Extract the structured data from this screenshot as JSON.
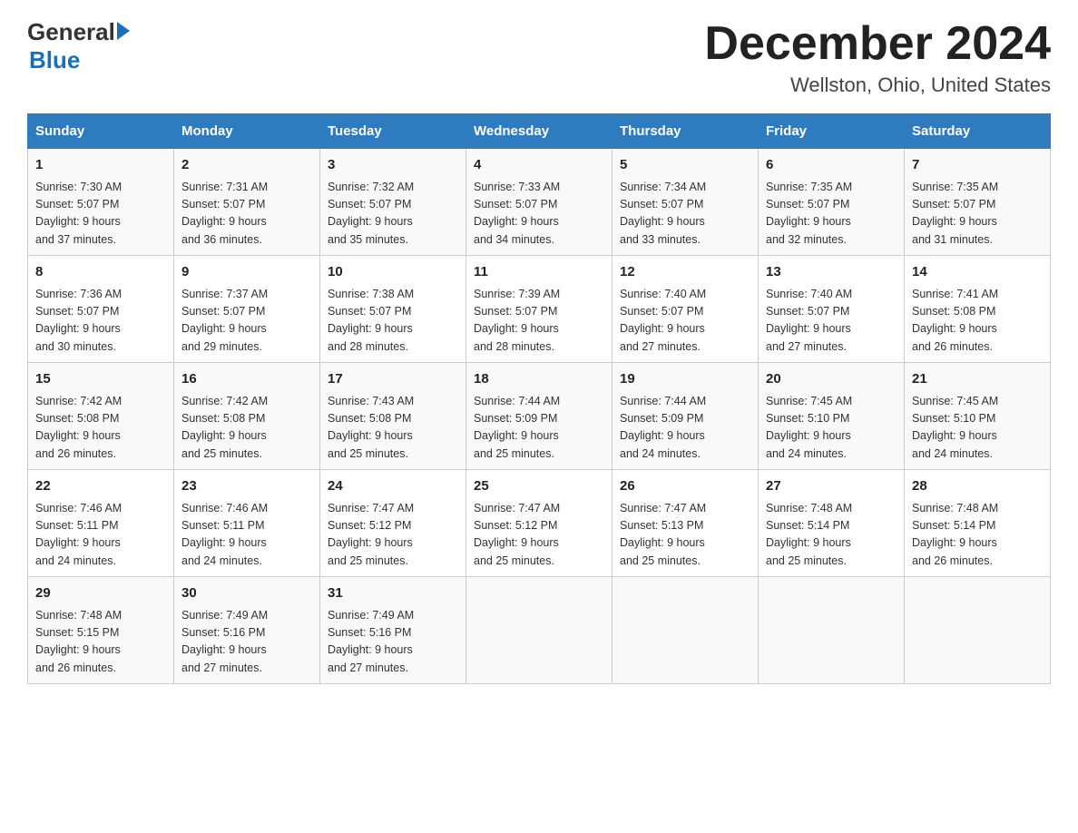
{
  "header": {
    "logo": {
      "general": "General",
      "arrow": "▶",
      "blue": "Blue"
    },
    "title": "December 2024",
    "location": "Wellston, Ohio, United States"
  },
  "days_of_week": [
    "Sunday",
    "Monday",
    "Tuesday",
    "Wednesday",
    "Thursday",
    "Friday",
    "Saturday"
  ],
  "weeks": [
    [
      {
        "day": "1",
        "sunrise": "7:30 AM",
        "sunset": "5:07 PM",
        "daylight": "9 hours and 37 minutes."
      },
      {
        "day": "2",
        "sunrise": "7:31 AM",
        "sunset": "5:07 PM",
        "daylight": "9 hours and 36 minutes."
      },
      {
        "day": "3",
        "sunrise": "7:32 AM",
        "sunset": "5:07 PM",
        "daylight": "9 hours and 35 minutes."
      },
      {
        "day": "4",
        "sunrise": "7:33 AM",
        "sunset": "5:07 PM",
        "daylight": "9 hours and 34 minutes."
      },
      {
        "day": "5",
        "sunrise": "7:34 AM",
        "sunset": "5:07 PM",
        "daylight": "9 hours and 33 minutes."
      },
      {
        "day": "6",
        "sunrise": "7:35 AM",
        "sunset": "5:07 PM",
        "daylight": "9 hours and 32 minutes."
      },
      {
        "day": "7",
        "sunrise": "7:35 AM",
        "sunset": "5:07 PM",
        "daylight": "9 hours and 31 minutes."
      }
    ],
    [
      {
        "day": "8",
        "sunrise": "7:36 AM",
        "sunset": "5:07 PM",
        "daylight": "9 hours and 30 minutes."
      },
      {
        "day": "9",
        "sunrise": "7:37 AM",
        "sunset": "5:07 PM",
        "daylight": "9 hours and 29 minutes."
      },
      {
        "day": "10",
        "sunrise": "7:38 AM",
        "sunset": "5:07 PM",
        "daylight": "9 hours and 28 minutes."
      },
      {
        "day": "11",
        "sunrise": "7:39 AM",
        "sunset": "5:07 PM",
        "daylight": "9 hours and 28 minutes."
      },
      {
        "day": "12",
        "sunrise": "7:40 AM",
        "sunset": "5:07 PM",
        "daylight": "9 hours and 27 minutes."
      },
      {
        "day": "13",
        "sunrise": "7:40 AM",
        "sunset": "5:07 PM",
        "daylight": "9 hours and 27 minutes."
      },
      {
        "day": "14",
        "sunrise": "7:41 AM",
        "sunset": "5:08 PM",
        "daylight": "9 hours and 26 minutes."
      }
    ],
    [
      {
        "day": "15",
        "sunrise": "7:42 AM",
        "sunset": "5:08 PM",
        "daylight": "9 hours and 26 minutes."
      },
      {
        "day": "16",
        "sunrise": "7:42 AM",
        "sunset": "5:08 PM",
        "daylight": "9 hours and 25 minutes."
      },
      {
        "day": "17",
        "sunrise": "7:43 AM",
        "sunset": "5:08 PM",
        "daylight": "9 hours and 25 minutes."
      },
      {
        "day": "18",
        "sunrise": "7:44 AM",
        "sunset": "5:09 PM",
        "daylight": "9 hours and 25 minutes."
      },
      {
        "day": "19",
        "sunrise": "7:44 AM",
        "sunset": "5:09 PM",
        "daylight": "9 hours and 24 minutes."
      },
      {
        "day": "20",
        "sunrise": "7:45 AM",
        "sunset": "5:10 PM",
        "daylight": "9 hours and 24 minutes."
      },
      {
        "day": "21",
        "sunrise": "7:45 AM",
        "sunset": "5:10 PM",
        "daylight": "9 hours and 24 minutes."
      }
    ],
    [
      {
        "day": "22",
        "sunrise": "7:46 AM",
        "sunset": "5:11 PM",
        "daylight": "9 hours and 24 minutes."
      },
      {
        "day": "23",
        "sunrise": "7:46 AM",
        "sunset": "5:11 PM",
        "daylight": "9 hours and 24 minutes."
      },
      {
        "day": "24",
        "sunrise": "7:47 AM",
        "sunset": "5:12 PM",
        "daylight": "9 hours and 25 minutes."
      },
      {
        "day": "25",
        "sunrise": "7:47 AM",
        "sunset": "5:12 PM",
        "daylight": "9 hours and 25 minutes."
      },
      {
        "day": "26",
        "sunrise": "7:47 AM",
        "sunset": "5:13 PM",
        "daylight": "9 hours and 25 minutes."
      },
      {
        "day": "27",
        "sunrise": "7:48 AM",
        "sunset": "5:14 PM",
        "daylight": "9 hours and 25 minutes."
      },
      {
        "day": "28",
        "sunrise": "7:48 AM",
        "sunset": "5:14 PM",
        "daylight": "9 hours and 26 minutes."
      }
    ],
    [
      {
        "day": "29",
        "sunrise": "7:48 AM",
        "sunset": "5:15 PM",
        "daylight": "9 hours and 26 minutes."
      },
      {
        "day": "30",
        "sunrise": "7:49 AM",
        "sunset": "5:16 PM",
        "daylight": "9 hours and 27 minutes."
      },
      {
        "day": "31",
        "sunrise": "7:49 AM",
        "sunset": "5:16 PM",
        "daylight": "9 hours and 27 minutes."
      },
      null,
      null,
      null,
      null
    ]
  ],
  "labels": {
    "sunrise": "Sunrise:",
    "sunset": "Sunset:",
    "daylight": "Daylight:"
  }
}
